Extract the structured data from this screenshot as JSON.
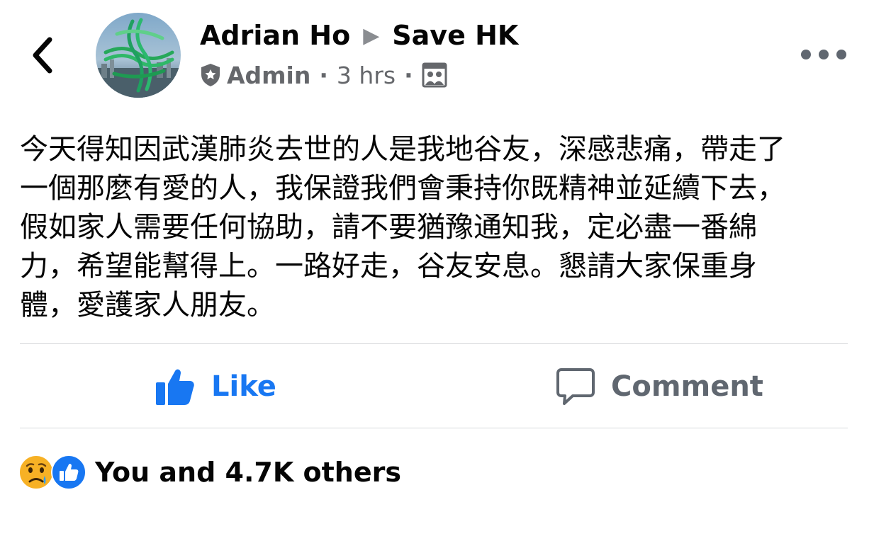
{
  "header": {
    "author_name": "Adrian Ho",
    "group_name": "Save HK",
    "role": "Admin",
    "time": "3 hrs",
    "separator": "·",
    "icons": {
      "back": "chevron-left-icon",
      "role_badge": "shield-icon",
      "audience": "group-audience-icon",
      "more": "more-dots-icon",
      "arrow": "right-triangle-icon"
    }
  },
  "post": {
    "text": "今天得知因武漢肺炎去世的人是我地谷友，深感悲痛，帶走了\n一個那麼有愛的人，我保證我們會秉持你既精神並延續下去，\n假如家人需要任何協助，請不要猶豫通知我，定必盡一番綿\n力，希望能幫得上。一路好走，谷友安息。懇請大家保重身\n體，愛護家人朋友。"
  },
  "actions": {
    "like_label": "Like",
    "comment_label": "Comment"
  },
  "reactions": {
    "summary": "You and 4.7K others",
    "icons": [
      "sad-reaction-icon",
      "like-reaction-icon"
    ]
  },
  "colors": {
    "accent": "#1877f2",
    "secondary_text": "#65676b",
    "divider": "#d7d9dc"
  }
}
